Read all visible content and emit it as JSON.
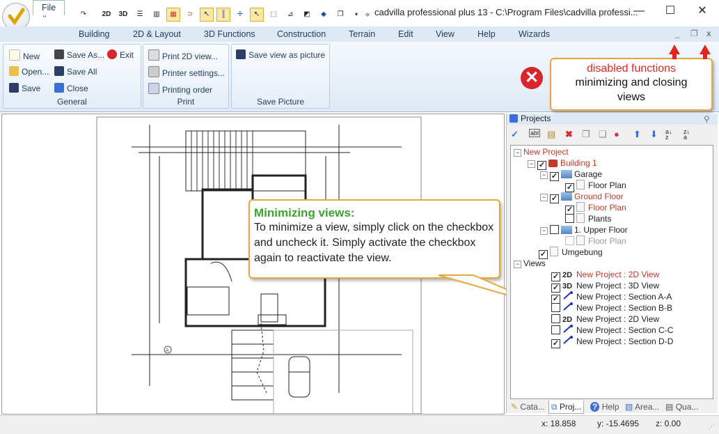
{
  "window": {
    "title": "cadvilla professional plus 13 - C:\\Program Files\\cadvilla professi...",
    "controls": {
      "minimize": "—",
      "maximize": "☐",
      "close": "✕"
    }
  },
  "quick_access": [
    "2D",
    "3D"
  ],
  "menu_tabs": [
    "File",
    "Building",
    "2D & Layout",
    "3D Functions",
    "Construction",
    "Terrain",
    "Edit",
    "View",
    "Help",
    "Wizards"
  ],
  "doc_controls": {
    "minimize": "_",
    "restore": "❐",
    "close": "x"
  },
  "ribbon": {
    "general": {
      "label": "General",
      "buttons": {
        "new": "New",
        "save_as": "Save As...",
        "exit": "Exit",
        "open": "Open...",
        "save_all": "Save All",
        "save": "Save",
        "close": "Close"
      }
    },
    "print": {
      "label": "Print",
      "buttons": {
        "print2d": "Print 2D view...",
        "printer_settings": "Printer settings...",
        "printing_order": "Printing order"
      }
    },
    "save_picture": {
      "label": "Save Picture",
      "buttons": {
        "save_view": "Save view as picture"
      }
    }
  },
  "annotations": {
    "disabled": {
      "title": "disabled functions",
      "body": "minimizing and closing views"
    },
    "minimizing": {
      "title": "Minimizing views:",
      "body": "To minimize a view, simply click on the checkbox and uncheck it. Simply activate the checkbox again to reactivate the view."
    }
  },
  "projects_panel": {
    "title": "Projects",
    "tree": {
      "root": "New Project",
      "building": "Building 1",
      "garage": "Garage",
      "garage_floor_plan": "Floor Plan",
      "ground_floor": "Ground Floor",
      "ground_floor_plan": "Floor Plan",
      "plants": "Plants",
      "upper_floor": "1. Upper Floor",
      "upper_floor_plan": "Floor Plan",
      "umgebung": "Umgebung",
      "views_label": "Views",
      "views": [
        {
          "prefix": "2D",
          "label": "New Project : 2D View",
          "checked": true,
          "highlight": true
        },
        {
          "prefix": "3D",
          "label": "New Project : 3D View",
          "checked": true,
          "highlight": false
        },
        {
          "prefix": "",
          "label": "New Project : Section A-A",
          "checked": true,
          "highlight": false
        },
        {
          "prefix": "",
          "label": "New Project : Section B-B",
          "checked": false,
          "highlight": false
        },
        {
          "prefix": "2D",
          "label": "New Project : 2D View",
          "checked": false,
          "highlight": false
        },
        {
          "prefix": "",
          "label": "New Project : Section C-C",
          "checked": false,
          "highlight": false
        },
        {
          "prefix": "",
          "label": "New Project : Section D-D",
          "checked": true,
          "highlight": false
        }
      ]
    },
    "bottom_tabs": [
      "Cata...",
      "Proj...",
      "Help",
      "Area...",
      "Qua..."
    ]
  },
  "drawing": {
    "marker": "A"
  },
  "status": {
    "x": "x: 18.858",
    "y": "y: -15.4695",
    "z": "z: 0.00"
  },
  "colors": {
    "accent": "#e8a73a",
    "callout_title": "#3aa52b",
    "disabled_title": "#e0261f",
    "tree_red": "#c0392b"
  }
}
